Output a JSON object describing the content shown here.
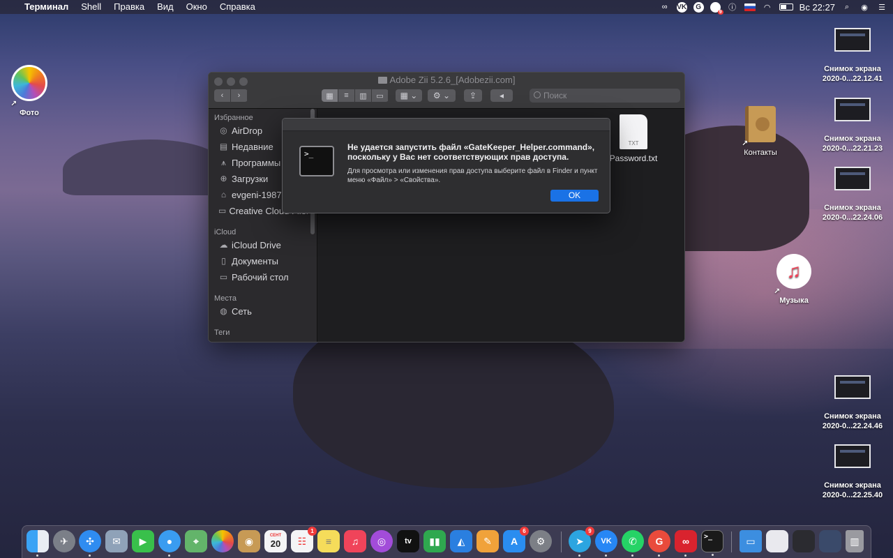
{
  "menubar": {
    "app_name": "Терминал",
    "items": [
      "Shell",
      "Правка",
      "Вид",
      "Окно",
      "Справка"
    ],
    "vk_label": "VK",
    "g_label": "G",
    "notif_badge": "9",
    "clock": "Вс 22:27"
  },
  "desktop": {
    "photos_label": "Фото",
    "contacts_label": "Контакты",
    "music_label": "Музыка",
    "screenshots": [
      {
        "line1": "Снимок экрана",
        "line2": "2020-0...22.12.41"
      },
      {
        "line1": "Снимок экрана",
        "line2": "2020-0...22.21.23"
      },
      {
        "line1": "Снимок экрана",
        "line2": "2020-0...22.24.06"
      },
      {
        "line1": "Снимок экрана",
        "line2": "2020-0...22.24.46"
      },
      {
        "line1": "Снимок экрана",
        "line2": "2020-0...22.25.40"
      }
    ]
  },
  "finder": {
    "title": "Adobe Zii 5.2.6_[Adobezii.com]",
    "search_placeholder": "Поиск",
    "sections": {
      "favorites": "Избранное",
      "icloud": "iCloud",
      "places": "Места",
      "tags": "Теги"
    },
    "favorites": [
      "AirDrop",
      "Недавние",
      "Программы",
      "Загрузки",
      "evgeni-1987",
      "Creative Cloud Files"
    ],
    "icloud": [
      "iCloud Drive",
      "Документы",
      "Рабочий стол"
    ],
    "places": [
      "Сеть"
    ],
    "file": {
      "name": "Password.txt",
      "type": "TXT"
    }
  },
  "alert": {
    "title": "Не удается запустить файл «GateKeeper_Helper.command», поскольку у Вас нет соответствующих прав доступа.",
    "message": "Для просмотра или изменения прав доступа выберите файл в Finder и пункт меню «Файл» > «Свойства».",
    "ok_label": "OK",
    "icon_text": ">_"
  },
  "dock": {
    "calendar_month": "СЕНТ",
    "calendar_day": "20",
    "reminders_badge": "1",
    "appstore_badge": "6",
    "telegram_badge": "9",
    "tv_label": "tv",
    "vk_label": "VK",
    "g_label": "G"
  },
  "colors": {
    "accent": "#1a72e6",
    "badge": "#f03a3a"
  }
}
